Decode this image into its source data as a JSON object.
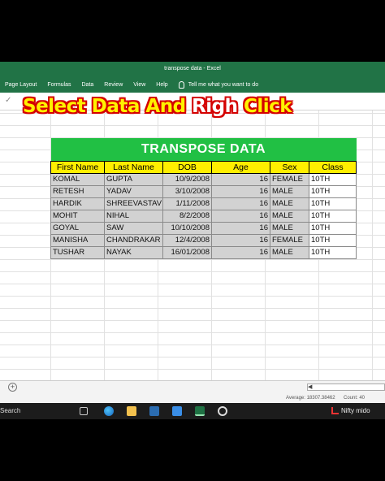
{
  "window": {
    "title": "transpose data  -  Excel"
  },
  "ribbon": {
    "tabs": [
      "Page Layout",
      "Formulas",
      "Data",
      "Review",
      "View",
      "Help"
    ],
    "tell_me": "Tell me what you want to do"
  },
  "banner": {
    "part1": "Select Data And ",
    "part2": "Righ",
    "part3": " Click"
  },
  "table": {
    "title": "TRANSPOSE DATA",
    "headers": [
      "First Name",
      "Last Name",
      "DOB",
      "Age",
      "Sex",
      "Class"
    ],
    "rows": [
      [
        "KOMAL",
        "GUPTA",
        "10/9/2008",
        "16",
        "FEMALE",
        "10TH"
      ],
      [
        "RETESH",
        "YADAV",
        "3/10/2008",
        "16",
        "MALE",
        "10TH"
      ],
      [
        "HARDIK",
        "SHREEVASTAV",
        "1/11/2008",
        "16",
        "MALE",
        "10TH"
      ],
      [
        "MOHIT",
        "NIHAL",
        "8/2/2008",
        "16",
        "MALE",
        "10TH"
      ],
      [
        "GOYAL",
        "SAW",
        "10/10/2008",
        "16",
        "MALE",
        "10TH"
      ],
      [
        "MANISHA",
        "CHANDRAKAR",
        "12/4/2008",
        "16",
        "FEMALE",
        "10TH"
      ],
      [
        "TUSHAR",
        "NAYAK",
        "16/01/2008",
        "16",
        "MALE",
        "10TH"
      ]
    ]
  },
  "status": {
    "average": "Average: 18307.38462",
    "count": "Count: 40"
  },
  "taskbar": {
    "search": "Search",
    "notification": "Nifty mido"
  },
  "colors": {
    "excel_green": "#217346",
    "title_green": "#21c044",
    "header_yellow": "#ffee00",
    "banner_yellow": "#fff200",
    "banner_outline": "#d40000"
  }
}
